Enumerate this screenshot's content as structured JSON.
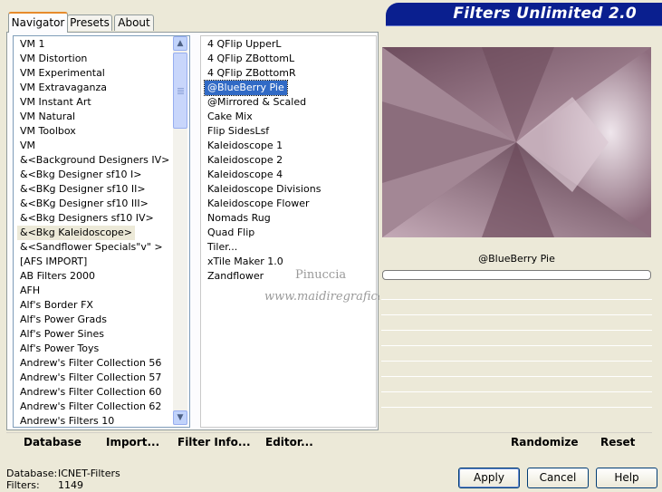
{
  "banner": {
    "title": "Filters Unlimited 2.0"
  },
  "tabs": [
    {
      "label": "Navigator",
      "active": true
    },
    {
      "label": "Presets",
      "active": false
    },
    {
      "label": "About",
      "active": false
    }
  ],
  "categories": [
    "VM 1",
    "VM Distortion",
    "VM Experimental",
    "VM Extravaganza",
    "VM Instant Art",
    "VM Natural",
    "VM Toolbox",
    "VM",
    "&<Background Designers IV>",
    "&<Bkg Designer sf10 I>",
    "&<BKg Designer sf10 II>",
    "&<BKg Designer sf10 III>",
    "&<Bkg Designers sf10 IV>",
    "&<Bkg Kaleidoscope>",
    "&<Sandflower Specials\"v\" >",
    "[AFS IMPORT]",
    "AB Filters 2000",
    "AFH",
    "Alf's Border FX",
    "Alf's Power Grads",
    "Alf's Power Sines",
    "Alf's Power Toys",
    "Andrew's Filter Collection 56",
    "Andrew's Filter Collection 57",
    "Andrew's Filter Collection 60",
    "Andrew's Filter Collection 62",
    "Andrew's Filters 10"
  ],
  "selected_category": "&<Bkg Kaleidoscope>",
  "filters": [
    "4 QFlip UpperL",
    "4 QFlip ZBottomL",
    "4 QFlip ZBottomR",
    "@BlueBerry Pie",
    "@Mirrored & Scaled",
    "Cake Mix",
    "Flip SidesLsf",
    "Kaleidoscope 1",
    "Kaleidoscope 2",
    "Kaleidoscope 4",
    "Kaleidoscope Divisions",
    "Kaleidoscope Flower",
    "Nomads Rug",
    "Quad Flip",
    "Tiler...",
    "xTile Maker 1.0",
    "Zandflower"
  ],
  "selected_filter": "@BlueBerry Pie",
  "preview": {
    "filter_name": "@BlueBerry Pie"
  },
  "watermark": {
    "line1": "Pinuccia",
    "line2": "www.maidiregrafica.eu"
  },
  "scrollbar": {
    "up_icon": "chevron-up-icon",
    "down_icon": "chevron-down-icon"
  },
  "links": {
    "database": "Database",
    "import": "Import...",
    "filter_info": "Filter Info...",
    "editor": "Editor...",
    "randomize": "Randomize",
    "reset": "Reset"
  },
  "status": {
    "database_label": "Database:",
    "database_value": "ICNET-Filters",
    "filters_label": "Filters:",
    "filters_value": "1149"
  },
  "buttons": {
    "apply": "Apply",
    "cancel": "Cancel",
    "help": "Help"
  },
  "colors": {
    "banner": "#0a1f8f",
    "selection": "#316ac5",
    "preview_base": "#8e6d7e"
  }
}
